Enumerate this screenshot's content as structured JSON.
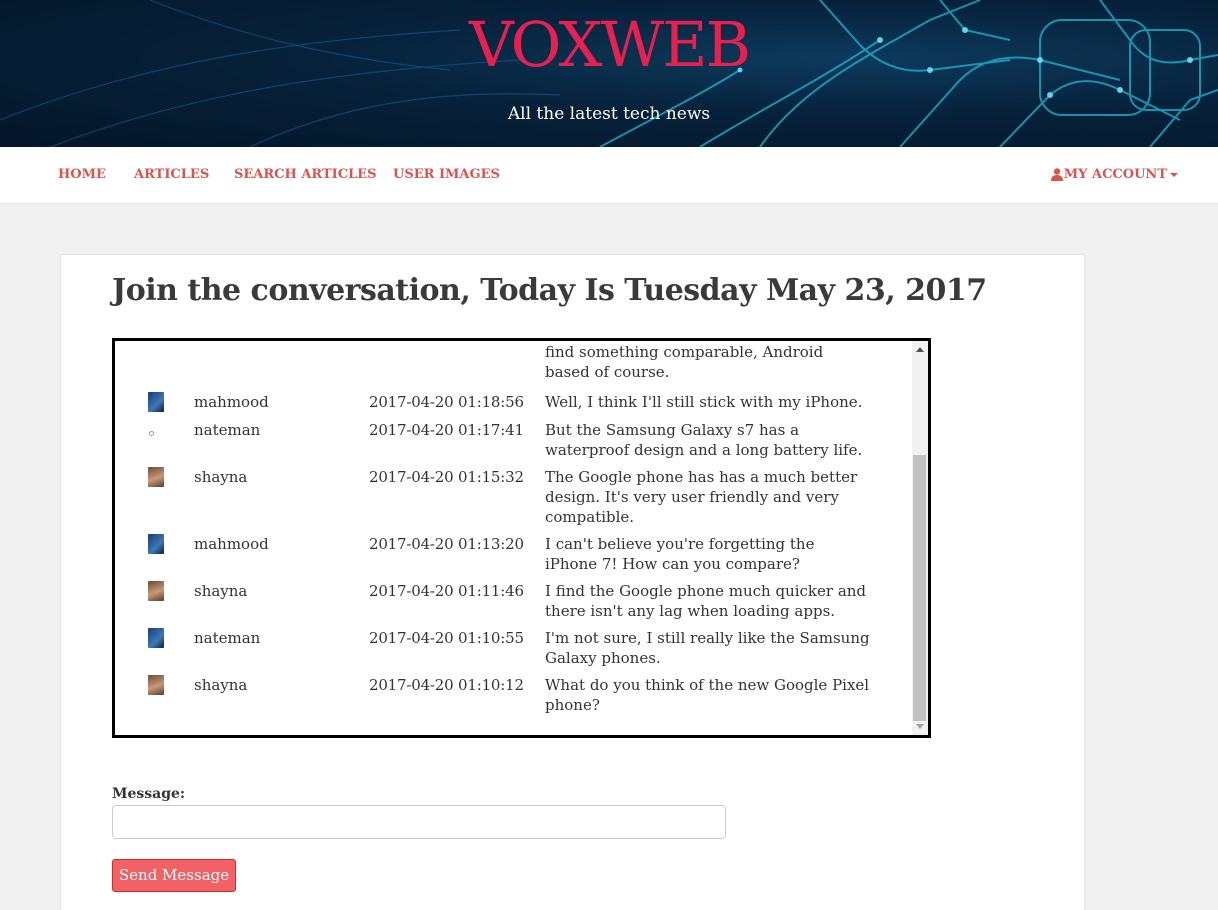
{
  "header": {
    "brand": "VOXWEB",
    "tagline": "All the latest tech news"
  },
  "nav": {
    "items": [
      "HOME",
      "ARTICLES",
      "SEARCH ARTICLES",
      "USER IMAGES"
    ],
    "account_label": "MY ACCOUNT"
  },
  "page": {
    "title": "Join the conversation, Today Is Tuesday May 23, 2017"
  },
  "chat": {
    "messages": [
      {
        "user": "",
        "time": "",
        "text": "with the Samsung Galaxy series until I find something comparable, Android based of course.",
        "avatar": "none"
      },
      {
        "user": "mahmood",
        "time": "2017-04-20 01:18:56",
        "text": "Well, I think I'll still stick with my iPhone.",
        "avatar": "blue-avatar"
      },
      {
        "user": "nateman",
        "time": "2017-04-20 01:17:41",
        "text": "But the Samsung Galaxy s7 has a waterproof design and a long battery life.",
        "avatar": "broken-image"
      },
      {
        "user": "shayna",
        "time": "2017-04-20 01:15:32",
        "text": "The Google phone has has a much better design. It's very user friendly and very compatible.",
        "avatar": "brown-avatar"
      },
      {
        "user": "mahmood",
        "time": "2017-04-20 01:13:20",
        "text": "I can't believe you're forgetting the iPhone 7! How can you compare?",
        "avatar": "blue-avatar"
      },
      {
        "user": "shayna",
        "time": "2017-04-20 01:11:46",
        "text": "I find the Google phone much quicker and there isn't any lag when loading apps.",
        "avatar": "brown-avatar"
      },
      {
        "user": "nateman",
        "time": "2017-04-20 01:10:55",
        "text": "I'm not sure, I still really like the Samsung Galaxy phones.",
        "avatar": "blue-avatar"
      },
      {
        "user": "shayna",
        "time": "2017-04-20 01:10:12",
        "text": "What do you think of the new Google Pixel phone?",
        "avatar": "brown-avatar"
      }
    ]
  },
  "form": {
    "message_label": "Message:",
    "message_value": "",
    "send_label": "Send Message"
  },
  "colors": {
    "brand": "#e8204f",
    "nav_link": "#d9534f",
    "send_button": "#f16166"
  }
}
